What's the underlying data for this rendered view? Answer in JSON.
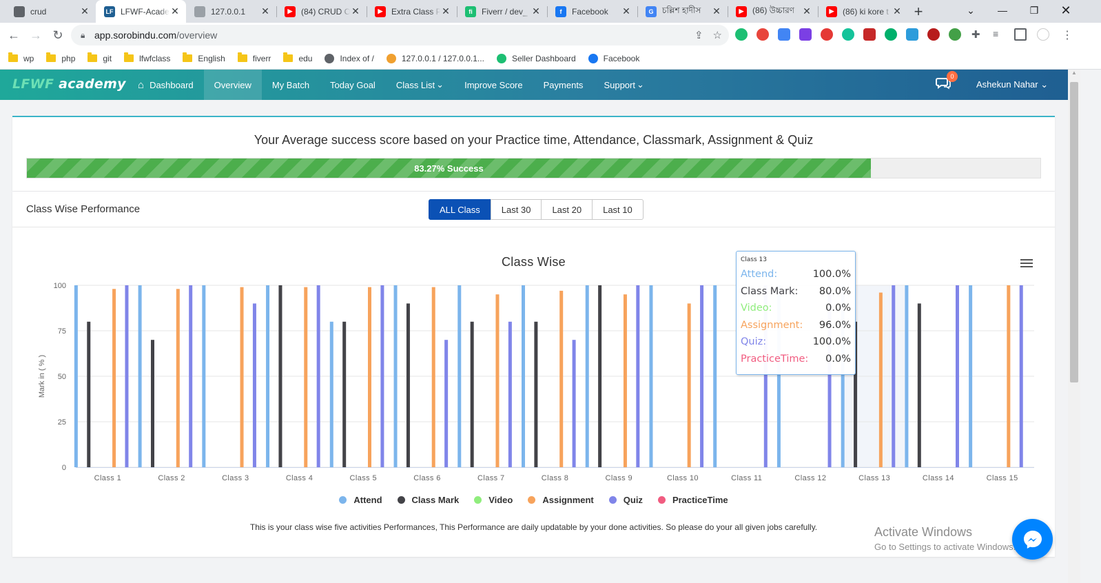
{
  "browser": {
    "tabs": [
      {
        "title": "crud",
        "fav_color": "#5f6368",
        "fav_text": "",
        "active": false
      },
      {
        "title": "LFWF-Academy",
        "fav_color": "#1f5f92",
        "fav_text": "LF",
        "active": true
      },
      {
        "title": "127.0.0.1",
        "fav_color": "#9aa0a6",
        "fav_text": "",
        "active": false
      },
      {
        "title": "(84) CRUD O",
        "fav_color": "#ff0000",
        "fav_text": "▶",
        "active": false
      },
      {
        "title": "Extra Class P",
        "fav_color": "#ff0000",
        "fav_text": "▶",
        "active": false
      },
      {
        "title": "Fiverr / dev_",
        "fav_color": "#1dbf73",
        "fav_text": "fi",
        "active": false
      },
      {
        "title": "Facebook",
        "fav_color": "#1877f2",
        "fav_text": "f",
        "active": false
      },
      {
        "title": "চল্লিশ হাদীস",
        "fav_color": "#4285f4",
        "fav_text": "G",
        "active": false
      },
      {
        "title": "(86) উচ্চারণ",
        "fav_color": "#ff0000",
        "fav_text": "▶",
        "active": false
      },
      {
        "title": "(86) ki kore t",
        "fav_color": "#ff0000",
        "fav_text": "▶",
        "active": false
      }
    ],
    "url_host": "app.sorobindu.com",
    "url_path": "/overview",
    "bookmarks": [
      {
        "label": "wp",
        "type": "folder"
      },
      {
        "label": "php",
        "type": "folder"
      },
      {
        "label": "git",
        "type": "folder"
      },
      {
        "label": "lfwfclass",
        "type": "folder"
      },
      {
        "label": "English",
        "type": "folder"
      },
      {
        "label": "fiverr",
        "type": "folder"
      },
      {
        "label": "edu",
        "type": "folder"
      },
      {
        "label": "Index of /",
        "type": "site",
        "color": "#5f6368"
      },
      {
        "label": "127.0.0.1 / 127.0.0.1...",
        "type": "site",
        "color": "#f0a030"
      },
      {
        "label": "Seller Dashboard",
        "type": "site",
        "color": "#1dbf73"
      },
      {
        "label": "Facebook",
        "type": "site",
        "color": "#1877f2"
      }
    ]
  },
  "app": {
    "logo_a": "LFWF",
    "logo_b": " academy",
    "menu": [
      {
        "label": "Dashboard",
        "icon": "home-icon",
        "active": false
      },
      {
        "label": "Overview",
        "active": true
      },
      {
        "label": "My Batch",
        "active": false
      },
      {
        "label": "Today Goal",
        "active": false
      },
      {
        "label": "Class List",
        "caret": true,
        "active": false
      },
      {
        "label": "Improve Score",
        "active": false
      },
      {
        "label": "Payments",
        "active": false
      },
      {
        "label": "Support",
        "caret": true,
        "active": false
      }
    ],
    "chat_badge": "0",
    "user_name": "Ashekun Nahar"
  },
  "score": {
    "title": "Your Average success score based on your Practice time, Attendance, Classmark, Assignment & Quiz",
    "percent": 83.27,
    "label": "83.27% Success"
  },
  "performance": {
    "heading": "Class Wise Performance",
    "filters": [
      {
        "label": "ALL Class",
        "active": true
      },
      {
        "label": "Last 30",
        "active": false
      },
      {
        "label": "Last 20",
        "active": false
      },
      {
        "label": "Last 10",
        "active": false
      }
    ],
    "note": "This is your class wise five activities Performances, This Performance are daily updatable by your done activities. So please do your all given jobs carefully."
  },
  "chart_data": {
    "type": "bar",
    "title": "Class Wise",
    "xlabel": "",
    "ylabel": "Mark in ( % )",
    "ylim": [
      0,
      100
    ],
    "yticks": [
      0,
      25,
      50,
      75,
      100
    ],
    "legend_position": "bottom",
    "categories": [
      "Class 1",
      "Class 2",
      "Class 3",
      "Class 4",
      "Class 5",
      "Class 6",
      "Class 7",
      "Class 8",
      "Class 9",
      "Class 10",
      "Class 11",
      "Class 12",
      "Class 13",
      "Class 14",
      "Class 15"
    ],
    "series": [
      {
        "name": "Attend",
        "color": "#7cb5ec",
        "values": [
          100,
          100,
          100,
          100,
          80,
          100,
          100,
          100,
          100,
          100,
          100,
          100,
          100,
          100,
          100
        ]
      },
      {
        "name": "Class Mark",
        "color": "#434348",
        "values": [
          80,
          70,
          0,
          100,
          80,
          90,
          80,
          80,
          100,
          0,
          0,
          0,
          80,
          90,
          0
        ]
      },
      {
        "name": "Video",
        "color": "#90ed7d",
        "values": [
          0,
          0,
          0,
          0,
          0,
          0,
          0,
          0,
          0,
          0,
          0,
          0,
          0,
          0,
          0
        ]
      },
      {
        "name": "Assignment",
        "color": "#f7a35c",
        "values": [
          98,
          98,
          99,
          99,
          99,
          99,
          95,
          97,
          95,
          90,
          0,
          0,
          96,
          0,
          100
        ]
      },
      {
        "name": "Quiz",
        "color": "#8085e9",
        "values": [
          100,
          100,
          90,
          100,
          100,
          70,
          80,
          70,
          100,
          100,
          100,
          100,
          100,
          100,
          100
        ]
      },
      {
        "name": "PracticeTime",
        "color": "#f15c80",
        "values": [
          0,
          0,
          0,
          0,
          0,
          0,
          0,
          0,
          0,
          0,
          0,
          0,
          0,
          0,
          0
        ]
      }
    ],
    "highlight_category": "Class 13"
  },
  "tooltip": {
    "header": "Class 13",
    "rows": [
      {
        "label": "Attend:",
        "value": "100.0%",
        "color": "#7cb5ec"
      },
      {
        "label": "Class Mark:",
        "value": "80.0%",
        "color": "#434348"
      },
      {
        "label": "Video:",
        "value": "0.0%",
        "color": "#90ed7d"
      },
      {
        "label": "Assignment:",
        "value": "96.0%",
        "color": "#f7a35c"
      },
      {
        "label": "Quiz:",
        "value": "100.0%",
        "color": "#8085e9"
      },
      {
        "label": "PracticeTime:",
        "value": "0.0%",
        "color": "#f15c80"
      }
    ]
  },
  "watermark": {
    "line1": "Activate Windows",
    "line2": "Go to Settings to activate Windows."
  }
}
